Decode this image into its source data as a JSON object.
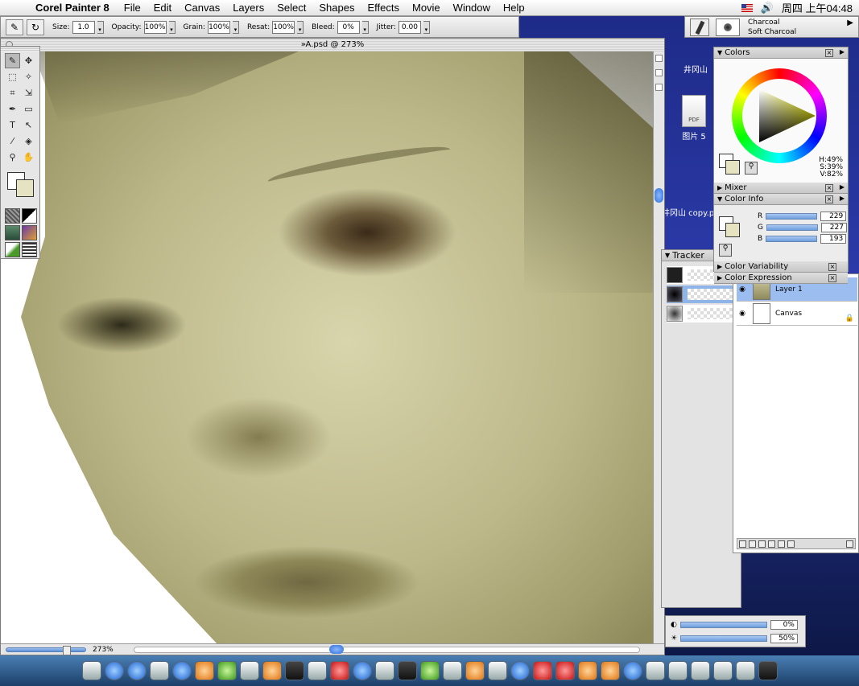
{
  "menubar": {
    "app_name": "Corel Painter 8",
    "menus": [
      "File",
      "Edit",
      "Canvas",
      "Layers",
      "Select",
      "Shapes",
      "Effects",
      "Movie",
      "Window",
      "Help"
    ],
    "clock": "周四 上午04:48"
  },
  "propbar": {
    "size_label": "Size:",
    "size_value": "1.0",
    "opacity_label": "Opacity:",
    "opacity_value": "100%",
    "grain_label": "Grain:",
    "grain_value": "100%",
    "resat_label": "Resat:",
    "resat_value": "100%",
    "bleed_label": "Bleed:",
    "bleed_value": "0%",
    "jitter_label": "Jitter:",
    "jitter_value": "0.00"
  },
  "brush": {
    "category": "Charcoal",
    "variant": "Soft Charcoal"
  },
  "document": {
    "title": "»A.psd @ 273%",
    "zoom": "273%"
  },
  "desktop": {
    "item1_label": "井冈山",
    "pdf_badge": "PDF",
    "item2_label": "图片 5",
    "item3_label": "井冈山 copy.p"
  },
  "panels": {
    "colors": {
      "title": "Colors",
      "h": "H:49%",
      "s": "S:39%",
      "v": "V:82%"
    },
    "mixer": {
      "title": "Mixer"
    },
    "color_info": {
      "title": "Color Info",
      "r_label": "R",
      "r_value": "229",
      "g_label": "G",
      "g_value": "227",
      "b_label": "B",
      "b_value": "193"
    },
    "color_variability": {
      "title": "Color Variability"
    },
    "color_expression": {
      "title": "Color Expression"
    },
    "tracker": {
      "title": "Tracker"
    },
    "layers": {
      "rows": [
        {
          "name": "Layer 1"
        },
        {
          "name": "Canvas"
        }
      ]
    },
    "adjust": {
      "opacity_value": "0%",
      "brightness_value": "50%"
    }
  },
  "colors": {
    "accent": "#2e6fd8",
    "skin": "#bcb88a",
    "secondary_swatch": "#e5e3c1"
  }
}
